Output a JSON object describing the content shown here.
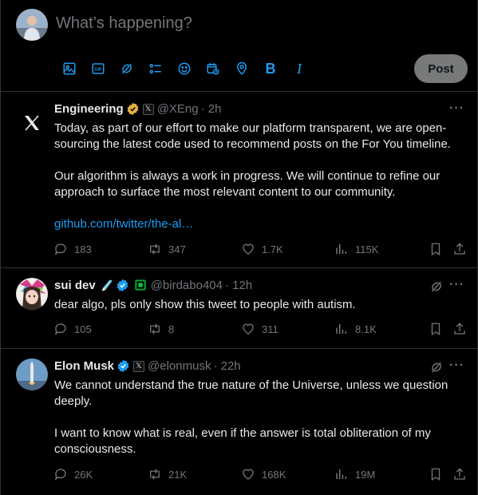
{
  "composer": {
    "placeholder": "What’s happening?",
    "post_label": "Post",
    "tools": [
      "image-icon",
      "gif-icon",
      "grok-icon",
      "poll-icon",
      "emoji-icon",
      "schedule-icon",
      "location-icon",
      "bold-icon",
      "italic-icon"
    ],
    "bold_glyph": "B",
    "italic_glyph": "I",
    "gif_glyph": "GIF"
  },
  "tweets": [
    {
      "name": "Engineering",
      "handle": "@XEng",
      "time": "· 2h",
      "body1": "Today, as part of our effort to make our platform transparent, we are open-sourcing the latest code used to recommend posts on the For You timeline.",
      "body2": "Our algorithm is always a work in progress. We will continue to refine our approach to surface the most relevant content to our community.",
      "link": "github.com/twitter/the-al…",
      "replies": "183",
      "reposts": "347",
      "likes": "1.7K",
      "views": "115K"
    },
    {
      "name": "sui dev",
      "handle": "@birdabo404",
      "time": "· 12h",
      "body1": "dear algo, pls only show this tweet to people with autism.",
      "replies": "105",
      "reposts": "8",
      "likes": "311",
      "views": "8.1K"
    },
    {
      "name": "Elon Musk",
      "handle": "@elonmusk",
      "time": "· 22h",
      "body1": "We cannot understand the true nature of the Universe, unless we question deeply.",
      "body2": "I want to know what is real, even if the answer is total obliteration of my consciousness.",
      "replies": "26K",
      "reposts": "21K",
      "likes": "168K",
      "views": "19M"
    }
  ],
  "more_glyph": "···",
  "x_glyph": "𝕏",
  "colors": {
    "accent": "#1d9bf0",
    "muted": "#71767b",
    "gold": "#e5b33e",
    "verified": "#1d9bf0"
  }
}
